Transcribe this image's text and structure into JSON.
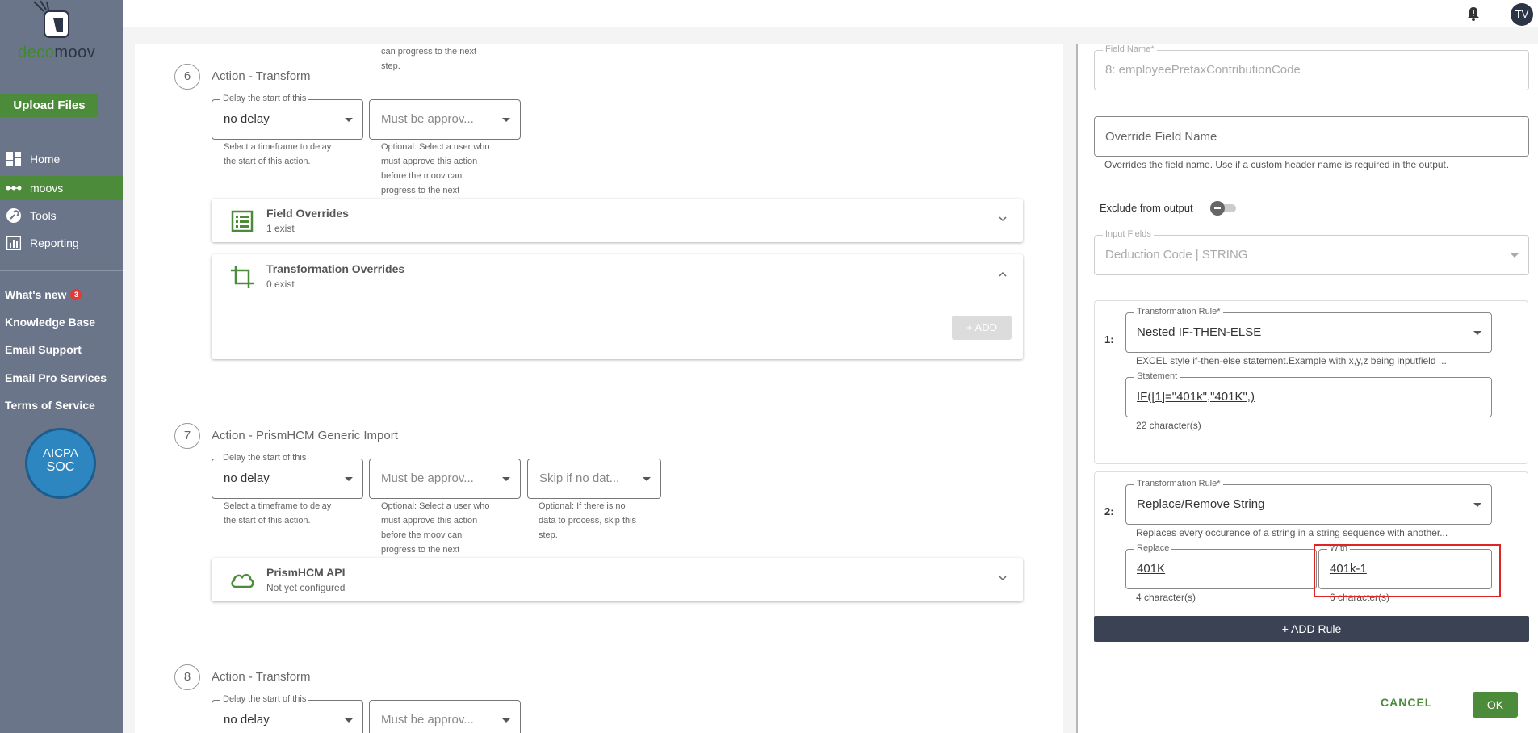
{
  "sidebar": {
    "logo_prefix": "deco",
    "logo_suffix": "moov",
    "upload_label": "Upload Files",
    "nav": [
      {
        "label": "Home",
        "icon": "dashboard-icon"
      },
      {
        "label": "moovs",
        "icon": "dots-icon",
        "active": true
      },
      {
        "label": "Tools",
        "icon": "wrench-icon"
      },
      {
        "label": "Reporting",
        "icon": "chart-icon"
      }
    ],
    "links": {
      "whats_new": "What's new",
      "whats_new_count": "3",
      "knowledge_base": "Knowledge Base",
      "email_support": "Email Support",
      "email_pro": "Email Pro Services",
      "terms": "Terms of Service"
    },
    "soc_top": "AICPA",
    "soc_bottom": "SOC"
  },
  "topbar": {
    "avatar_initials": "TV"
  },
  "steps": {
    "s6": {
      "num": "6",
      "title": "Action - Transform",
      "top_helper": "can progress to the next step.",
      "delay_label": "Delay the start of this",
      "delay_value": "no delay",
      "approve_placeholder": "Must be approv...",
      "delay_help": "Select a timeframe to delay the start of this action.",
      "approve_help": "Optional: Select a user who must approve this action before the moov can progress to the next",
      "field_overrides_title": "Field Overrides",
      "field_overrides_sub": "1 exist",
      "transform_overrides_title": "Transformation Overrides",
      "transform_overrides_sub": "0 exist",
      "add_label": "+ ADD"
    },
    "s7": {
      "num": "7",
      "title": "Action - PrismHCM Generic Import",
      "delay_label": "Delay the start of this",
      "delay_value": "no delay",
      "approve_placeholder": "Must be approv...",
      "skip_placeholder": "Skip if no dat...",
      "delay_help": "Select a timeframe to delay the start of this action.",
      "approve_help": "Optional: Select a user who must approve this action before the moov can progress to the next",
      "skip_help": "Optional: If there is no data to process, skip this step.",
      "api_title": "PrismHCM API",
      "api_sub": "Not yet configured"
    },
    "s8": {
      "num": "8",
      "title": "Action - Transform",
      "delay_label": "Delay the start of this",
      "delay_value": "no delay",
      "approve_placeholder": "Must be approv..."
    }
  },
  "drawer": {
    "field_name_label": "Field Name*",
    "field_name_value": "8: employeePretaxContributionCode",
    "override_placeholder": "Override Field Name",
    "override_help": "Overrides the field name. Use if a custom header name is required in the output.",
    "exclude_label": "Exclude from output",
    "input_fields_label": "Input Fields",
    "input_fields_value": "Deduction Code | STRING",
    "rule1": {
      "num": "1:",
      "rule_label": "Transformation Rule*",
      "rule_value": "Nested IF-THEN-ELSE",
      "rule_help": "EXCEL style if-then-else statement.Example with x,y,z being inputfield ...",
      "statement_label": "Statement",
      "statement_value": "IF([1]=\"401k\",\"401K\",)",
      "statement_count": "22 character(s)"
    },
    "rule2": {
      "num": "2:",
      "rule_label": "Transformation Rule*",
      "rule_value": "Replace/Remove String",
      "rule_help": "Replaces every occurence of a string in a string sequence with another...",
      "replace_label": "Replace",
      "replace_value": "401K",
      "replace_count": "4 character(s)",
      "with_label": "With",
      "with_value": "401k-1",
      "with_count": "6 character(s)"
    },
    "add_rule_label": "+ ADD Rule",
    "cancel_label": "CANCEL",
    "ok_label": "OK"
  },
  "colors": {
    "brand_green": "#4c8b3a",
    "sidebar_bg": "#6b7589",
    "dark_button": "#3a4254",
    "highlight_red": "#e02424"
  }
}
